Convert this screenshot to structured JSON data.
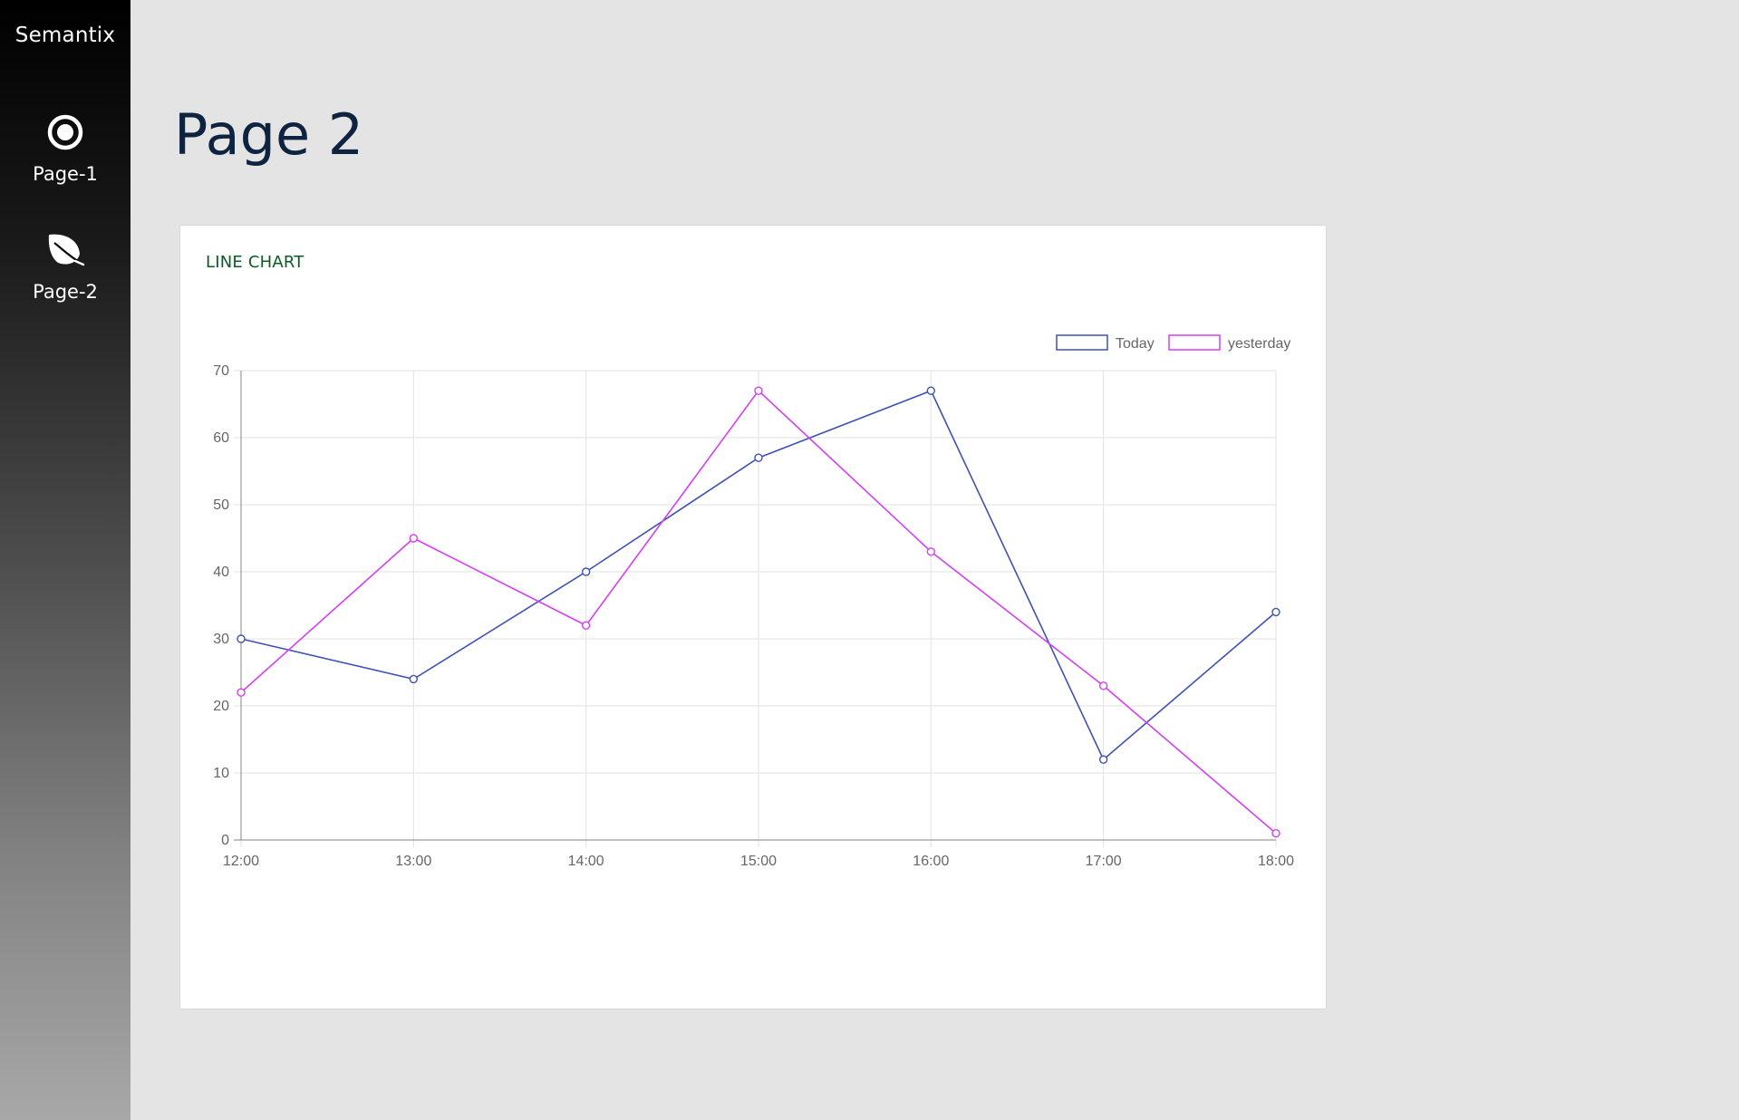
{
  "app": {
    "brand": "Semantix"
  },
  "sidebar": {
    "items": [
      {
        "label": "Page-1",
        "icon": "target-icon"
      },
      {
        "label": "Page-2",
        "icon": "leaf-icon"
      }
    ]
  },
  "main": {
    "page_title": "Page 2",
    "card_title": "LINE CHART"
  },
  "chart_data": {
    "type": "line",
    "title": "",
    "xlabel": "",
    "ylabel": "",
    "categories": [
      "12:00",
      "13:00",
      "14:00",
      "15:00",
      "16:00",
      "17:00",
      "18:00"
    ],
    "ylim": [
      0,
      70
    ],
    "yticks": [
      0,
      10,
      20,
      30,
      40,
      50,
      60,
      70
    ],
    "grid": true,
    "legend_position": "top-right",
    "series": [
      {
        "name": "Today",
        "color": "#3f51b5",
        "values": [
          30,
          24,
          40,
          57,
          67,
          12,
          34
        ]
      },
      {
        "name": "yesterday",
        "color": "#d63ef5",
        "values": [
          22,
          45,
          32,
          67,
          43,
          23,
          1
        ]
      }
    ]
  }
}
